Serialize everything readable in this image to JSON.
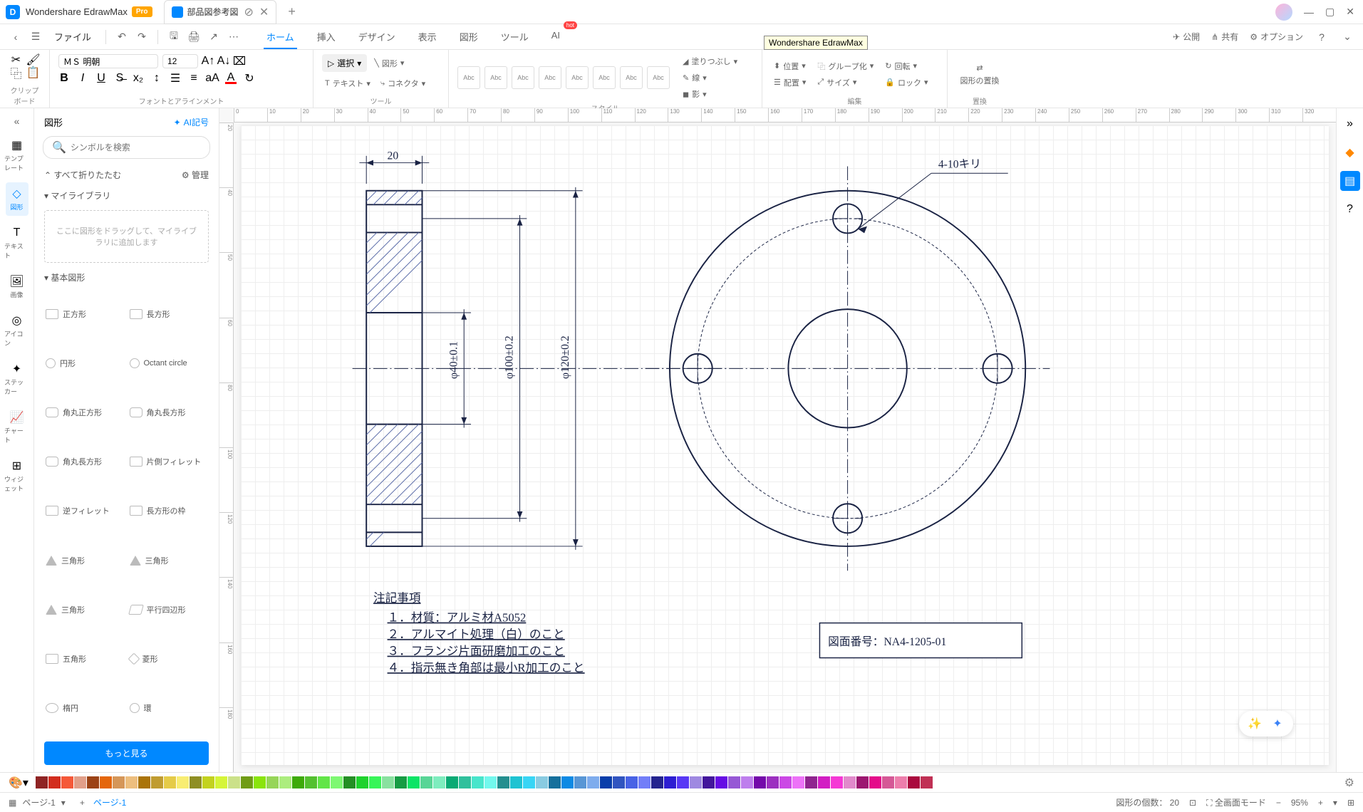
{
  "app": {
    "name": "Wondershare EdrawMax",
    "badge": "Pro"
  },
  "tab": {
    "title": "部品図参考図"
  },
  "tooltip": "Wondershare EdrawMax",
  "menu": {
    "file": "ファイル"
  },
  "ribbon_tabs": {
    "home": "ホーム",
    "insert": "挿入",
    "design": "デザイン",
    "view": "表示",
    "shape": "図形",
    "tool": "ツール",
    "ai": "AI",
    "hot": "hot"
  },
  "topbar": {
    "publish": "公開",
    "share": "共有",
    "options": "オプション"
  },
  "ribbon": {
    "font": "ＭＳ 明朝",
    "size": "12",
    "select": "選択",
    "shape": "図形",
    "text": "テキスト",
    "connector": "コネクタ",
    "fill": "塗りつぶし",
    "line": "線",
    "shadow": "影",
    "pos": "位置",
    "align": "配置",
    "group": "グループ化",
    "sz": "サイズ",
    "rotate": "回転",
    "lock": "ロック",
    "replace": "図形の置換",
    "style_label": "Abc",
    "grp_clipboard": "クリップボード",
    "grp_font": "フォントとアラインメント",
    "grp_tool": "ツール",
    "grp_style": "スタイル",
    "grp_edit": "編集",
    "grp_replace": "置換"
  },
  "rail": {
    "template": "テンプレート",
    "shapes": "図形",
    "text": "テキスト",
    "image": "画像",
    "icon": "アイコン",
    "sticker": "ステッカー",
    "chart": "チャート",
    "widget": "ウィジェット"
  },
  "panel": {
    "title": "図形",
    "ai": "AI記号",
    "search_ph": "シンボルを検索",
    "collapse": "すべて折りたたむ",
    "manage": "管理",
    "mylib": "マイライブラリ",
    "drop": "ここに図形をドラッグして、マイライブラリに追加します",
    "basic": "基本図形",
    "more": "もっと見る",
    "shapes": [
      "正方形",
      "長方形",
      "円形",
      "Octant circle",
      "角丸正方形",
      "角丸長方形",
      "角丸長方形",
      "片側フィレット",
      "逆フィレット",
      "長方形の枠",
      "三角形",
      "三角形",
      "三角形",
      "平行四辺形",
      "五角形",
      "菱形",
      "楕円",
      "環"
    ]
  },
  "drawing": {
    "dim_20": "20",
    "dim_40": "φ40±0.1",
    "dim_100": "φ100±0.2",
    "dim_120": "φ120±0.2",
    "hole": "4-10キリ",
    "notes_title": "注記事項",
    "note1": "１．材質：アルミ材A5052",
    "note2": "２．アルマイト処理（白）のこと",
    "note3": "３．フランジ片面研磨加工のこと",
    "note4": "４．指示無き角部は最小R加工のこと",
    "dwg_no": "図面番号：NA4-1205-01"
  },
  "status": {
    "page": "ページ-1",
    "page_link": "ページ-1",
    "count_label": "図形の個数：",
    "count": "20",
    "fullscreen": "全画面モード",
    "zoom": "95%"
  },
  "ruler_h": [
    "0",
    "10",
    "20",
    "30",
    "40",
    "50",
    "60",
    "70",
    "80",
    "90",
    "100",
    "110",
    "120",
    "130",
    "140",
    "150",
    "160",
    "170",
    "180",
    "190",
    "200",
    "210",
    "220",
    "230",
    "240",
    "250",
    "260",
    "270",
    "280",
    "290",
    "300",
    "310",
    "320"
  ],
  "ruler_v": [
    "20",
    "40",
    "50",
    "60",
    "80",
    "100",
    "120",
    "140",
    "160",
    "180"
  ]
}
